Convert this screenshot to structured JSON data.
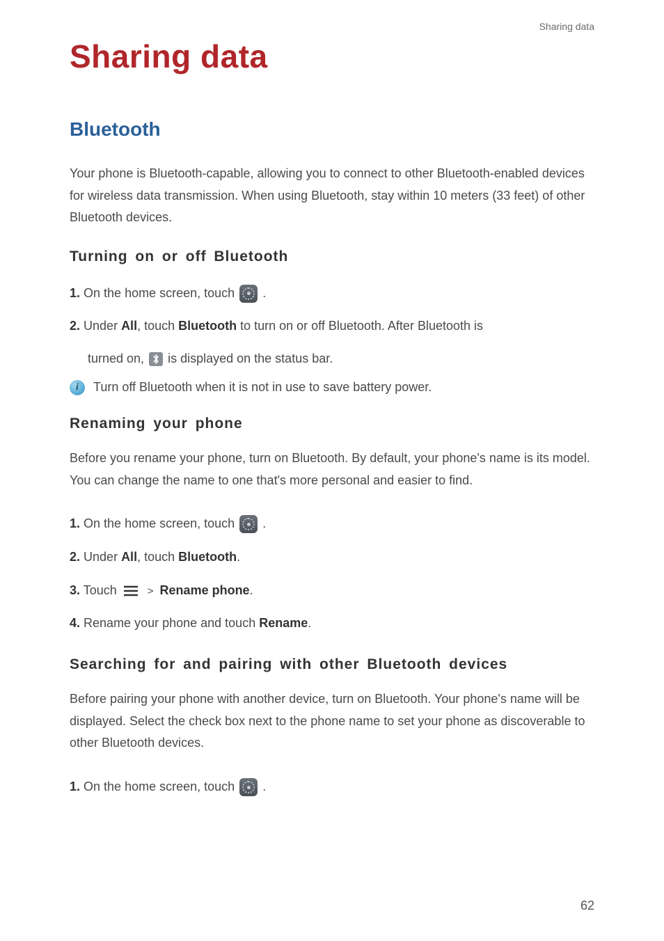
{
  "header": {
    "section_label": "Sharing data"
  },
  "title": "Sharing data",
  "sections": {
    "bluetooth": {
      "heading": "Bluetooth",
      "intro": "Your phone is Bluetooth-capable, allowing you to connect to other Bluetooth-enabled devices for wireless data transmission. When using Bluetooth, stay within 10 meters (33 feet) of other Bluetooth devices.",
      "sub1": {
        "heading": "Turning on or off Bluetooth",
        "steps": {
          "s1_num": "1.",
          "s1_a": "On the home screen, touch ",
          "s1_b": ".",
          "s2_num": "2.",
          "s2_a": "Under ",
          "s2_all": "All",
          "s2_b": ", touch ",
          "s2_bt": "Bluetooth",
          "s2_c": " to turn on or off Bluetooth. After Bluetooth is",
          "s2_d": "turned on, ",
          "s2_e": " is displayed on the status bar."
        },
        "tip": "Turn off Bluetooth when it is not in use to save battery power."
      },
      "sub2": {
        "heading": "Renaming your phone",
        "intro": "Before you rename your phone, turn on Bluetooth. By default, your phone's name is its model. You can change the name to one that's more personal and easier to find.",
        "steps": {
          "s1_num": "1.",
          "s1_a": "On the home screen, touch ",
          "s1_b": ".",
          "s2_num": "2.",
          "s2_a": "Under ",
          "s2_all": "All",
          "s2_b": ", touch ",
          "s2_bt": "Bluetooth",
          "s2_c": ".",
          "s3_num": "3.",
          "s3_a": "Touch ",
          "s3_gt": ">",
          "s3_rename": "Rename phone",
          "s3_b": ".",
          "s4_num": "4.",
          "s4_a": "Rename your phone and touch ",
          "s4_rename": "Rename",
          "s4_b": "."
        }
      },
      "sub3": {
        "heading": "Searching for and pairing with other Bluetooth devices",
        "intro": "Before pairing your phone with another device, turn on Bluetooth. Your phone's name will be displayed. Select the check box next to the phone name to set your phone as discoverable to other Bluetooth devices.",
        "steps": {
          "s1_num": "1.",
          "s1_a": "On the home screen, touch ",
          "s1_b": "."
        }
      }
    }
  },
  "page_number": "62",
  "icons": {
    "settings": "settings-icon",
    "bluetooth": "bluetooth-status-icon",
    "menu": "menu-icon",
    "info": "info-icon"
  }
}
